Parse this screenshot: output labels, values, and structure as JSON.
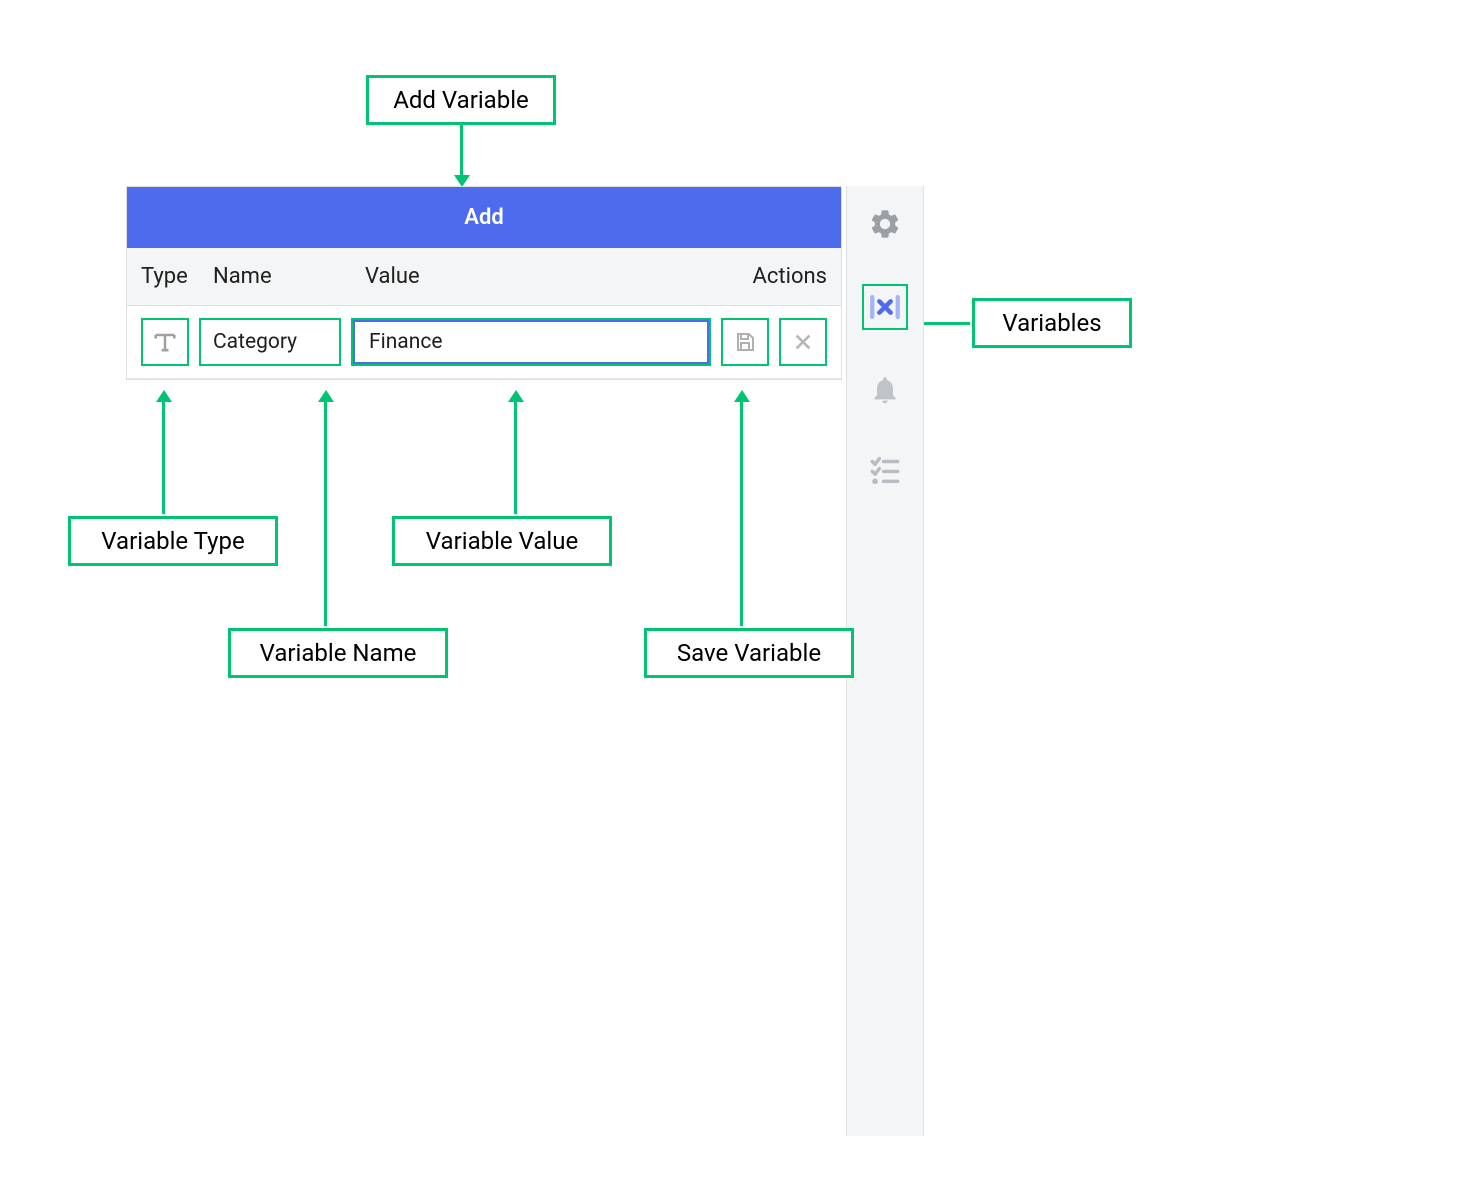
{
  "annotations": {
    "add_variable": "Add Variable",
    "variables": "Variables",
    "variable_type": "Variable Type",
    "variable_name": "Variable Name",
    "variable_value": "Variable Value",
    "save_variable": "Save Variable"
  },
  "panel": {
    "add_button": "Add",
    "headers": {
      "type": "Type",
      "name": "Name",
      "value": "Value",
      "actions": "Actions"
    },
    "row": {
      "name": "Category",
      "value": "Finance"
    }
  },
  "sidebar": {
    "items": [
      "Settings",
      "Variables",
      "Notifications",
      "Checklist"
    ]
  }
}
